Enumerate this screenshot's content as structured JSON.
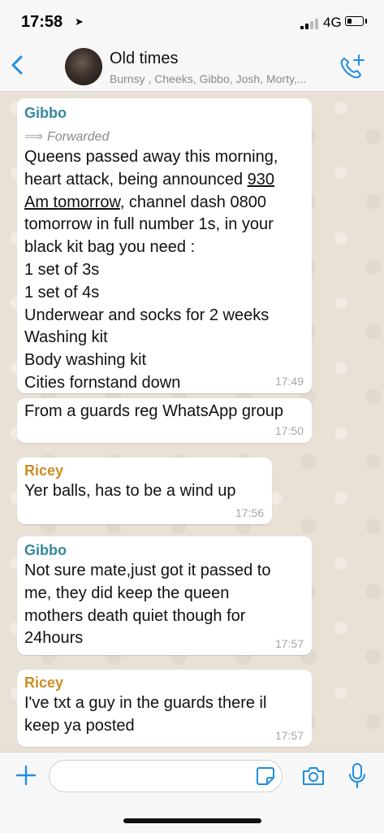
{
  "status_bar": {
    "time": "17:58",
    "location_icon": "location-arrow-icon",
    "network": "4G",
    "battery_level": 0.25
  },
  "header": {
    "back_icon": "chevron-left-icon",
    "title": "Old times",
    "members": "Burnsy , Cheeks, Gibbo, Josh, Morty,...",
    "call_icon": "add-call-icon"
  },
  "messages": [
    {
      "sender": "Gibbo",
      "forwarded": "Forwarded",
      "lines": [
        "Queens passed away this morning,",
        "heart attack, being announced 930",
        "Am tomorrow, channel dash 0800",
        "tomorrow in full number 1s, in your",
        "black kit bag you need :",
        "1 set of 3s",
        "1 set of 4s",
        "Underwear and socks for 2 weeks",
        "Washing kit",
        "Body washing kit",
        "Cities fornstand down"
      ],
      "time": "17:49"
    },
    {
      "lines": [
        "From a guards reg WhatsApp group"
      ],
      "time": "17:50"
    },
    {
      "sender": "Ricey",
      "lines": [
        "Yer balls, has to be a wind up"
      ],
      "time": "17:56"
    },
    {
      "sender": "Gibbo",
      "lines": [
        "Not sure mate,just got it passed to",
        "me, they did keep the queen",
        "mothers death quiet though for",
        "24hours"
      ],
      "time": "17:57"
    },
    {
      "sender": "Ricey",
      "lines": [
        "I've txt a guy in the guards there il",
        "keep ya posted"
      ],
      "time": "17:57"
    }
  ],
  "composer": {
    "input_value": "",
    "plus_icon": "plus-icon",
    "sticker_icon": "sticker-icon",
    "camera_icon": "camera-icon",
    "mic_icon": "microphone-icon"
  },
  "colors": {
    "accent": "#1f8ee0",
    "sender_gibbo": "#35899e",
    "sender_ricey": "#cc8d24",
    "chat_background": "#e9e1d6",
    "bubble": "#ffffff"
  }
}
